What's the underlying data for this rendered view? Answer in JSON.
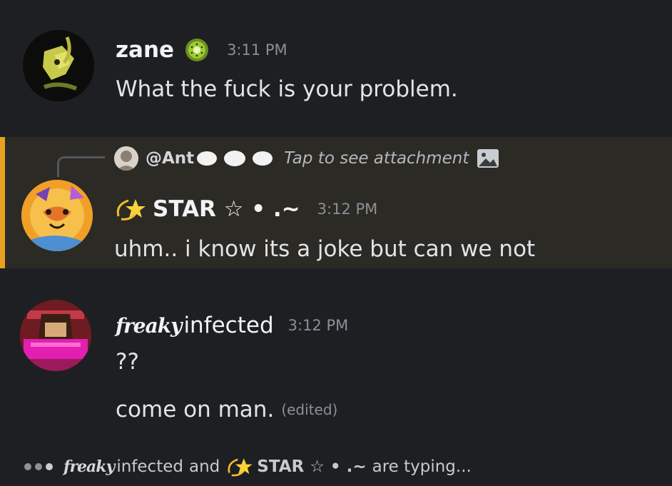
{
  "messages": [
    {
      "author": "zane",
      "badge_icon": "kiwi-icon",
      "time": "3:11 PM",
      "lines": [
        "What the fuck is your problem."
      ]
    },
    {
      "highlighted": true,
      "reply": {
        "user": "@Ant",
        "preview": "Tap to see attachment",
        "attachment_icon": "image-icon"
      },
      "author_icon": "dizzy-star-icon",
      "author": "STAR ☆ • .~",
      "time": "3:12 PM",
      "lines": [
        "uhm.. i know its a joke but can we not"
      ]
    },
    {
      "author_prefix": "freaky",
      "author": "infected",
      "time": "3:12 PM",
      "lines": [
        "??",
        "come on man."
      ],
      "edited_label": "(edited)"
    }
  ],
  "typing": {
    "user1_prefix": "freaky",
    "user1": "infected",
    "joiner": "and",
    "user2_icon": "dizzy-star-icon",
    "user2": "STAR ☆ • .~",
    "suffix": "are typing..."
  },
  "colors": {
    "background": "#1e1f22",
    "highlight_background": "#2b2a25",
    "highlight_bar": "#e8a11f",
    "timestamp": "#8c8f96"
  }
}
